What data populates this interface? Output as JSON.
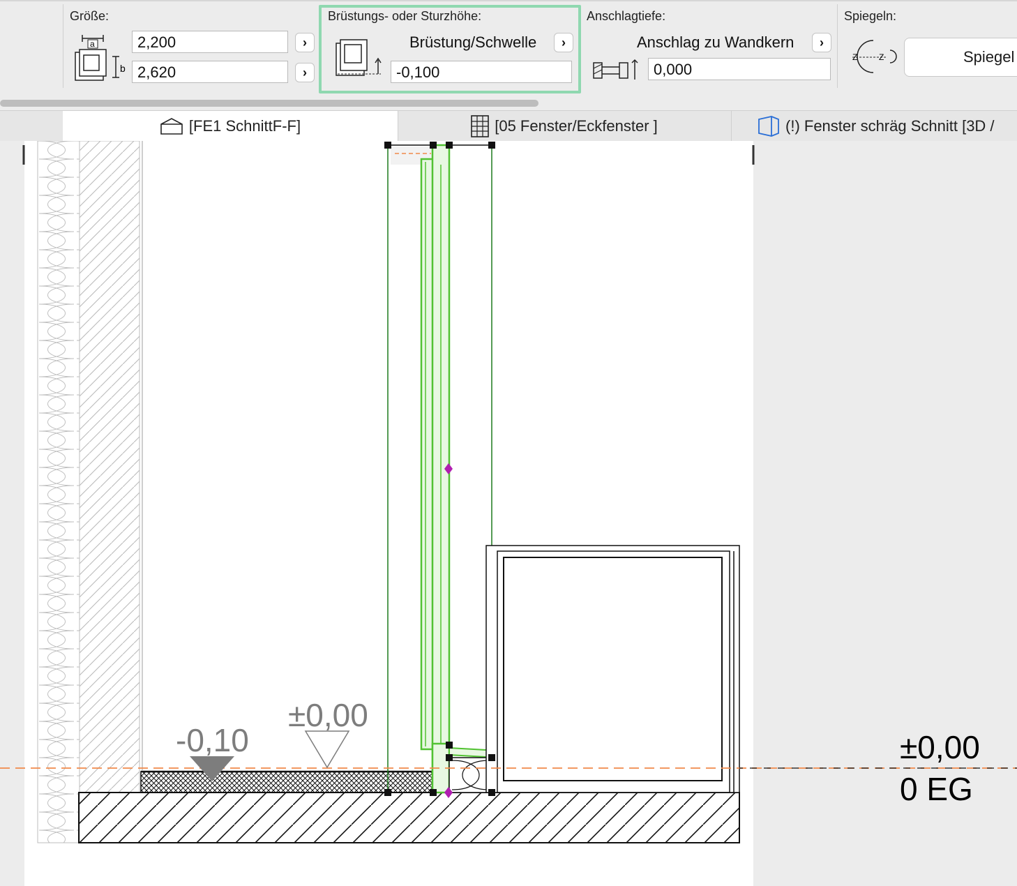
{
  "infobox": {
    "groesse": {
      "label": "Größe:",
      "width_value": "2,200",
      "height_value": "2,620",
      "width_icon_letter": "a",
      "height_icon_letter": "b"
    },
    "bruestung": {
      "label": "Brüstungs- oder Sturzhöhe:",
      "popup_value": "Brüstung/Schwelle",
      "value": "-0,100",
      "highlight_color": "#8fd8b0"
    },
    "anschlag": {
      "label": "Anschlagtiefe:",
      "popup_value": "Anschlag zu Wandkern",
      "value": "0,000"
    },
    "spiegeln": {
      "label": "Spiegeln:",
      "button_label": "Spiegel"
    }
  },
  "tabs": [
    {
      "label": "[FE1 SchnittF-F]",
      "icon": "section-icon",
      "active": true
    },
    {
      "label": "[05 Fenster/Eckfenster ]",
      "icon": "schedule-icon",
      "active": false
    },
    {
      "label": "(!) Fenster schräg Schnitt [3D /",
      "icon": "3d-view-icon",
      "active": false
    }
  ],
  "canvas": {
    "level_markers": [
      {
        "label": "-0,10",
        "marker": "filled-triangle"
      },
      {
        "label": "±0,00",
        "marker": "outline-triangle"
      }
    ],
    "story_level": {
      "elevation": "±0,00",
      "name": "0 EG"
    },
    "colors": {
      "selection": "#52c233",
      "reference_line": "#f08a4b",
      "marker_fill": "#7d7d7d",
      "hotspot": "#b01fb0"
    }
  }
}
